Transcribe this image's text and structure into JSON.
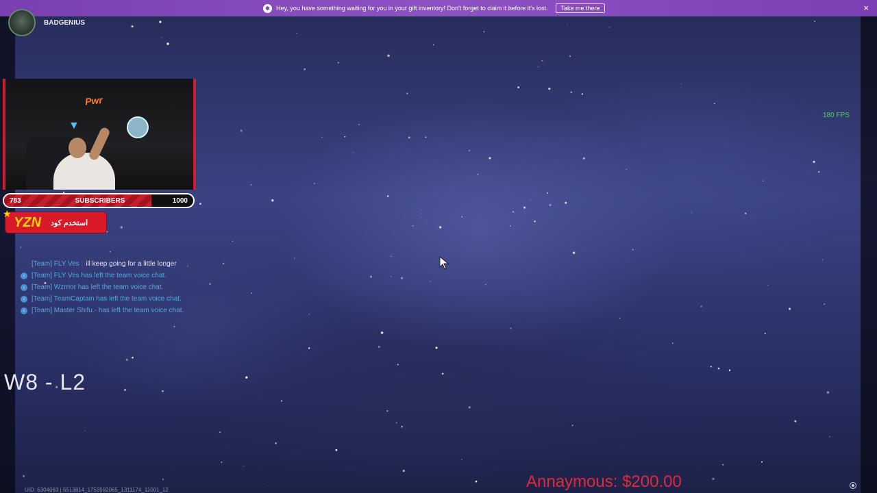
{
  "notification": {
    "message": "Hey, you have something waiting for you in your gift inventory! Don't forget to claim it before it's lost.",
    "button": "Take me there",
    "close": "×"
  },
  "streamer": {
    "name": "BADGENIUS"
  },
  "webcam": {
    "logo": "Pwr"
  },
  "subscribers": {
    "current": "783",
    "label": "SUBSCRIBERS",
    "goal": "1000",
    "progress_fraction": 0.78
  },
  "code_badge": {
    "code": "YZN",
    "text": "استخدم كود"
  },
  "chat": [
    {
      "type": "message",
      "prefix": "[Team] FLY Ves :",
      "text": "ill keep going for a little longer"
    },
    {
      "type": "system",
      "text": "[Team] FLY Ves has left the team voice chat."
    },
    {
      "type": "system",
      "text": "[Team] Wzrrior has left the team voice chat."
    },
    {
      "type": "system",
      "text": "[Team] TeamCaptain has left the team voice chat."
    },
    {
      "type": "system",
      "text": "[Team] Master Shifu.- has left the team voice chat."
    }
  ],
  "record": "W8 - L2",
  "fps": "180 FPS",
  "donation": "Annaymous: $200.00",
  "uid": "UID: 6304063 | 5513814_1753592065_1311174_11001_12",
  "colors": {
    "notification_bg": "#8e52c4",
    "fps": "#55c76a",
    "donation": "#e2283b",
    "accent_red": "#c91f2e",
    "chat_system": "#58a8de"
  }
}
